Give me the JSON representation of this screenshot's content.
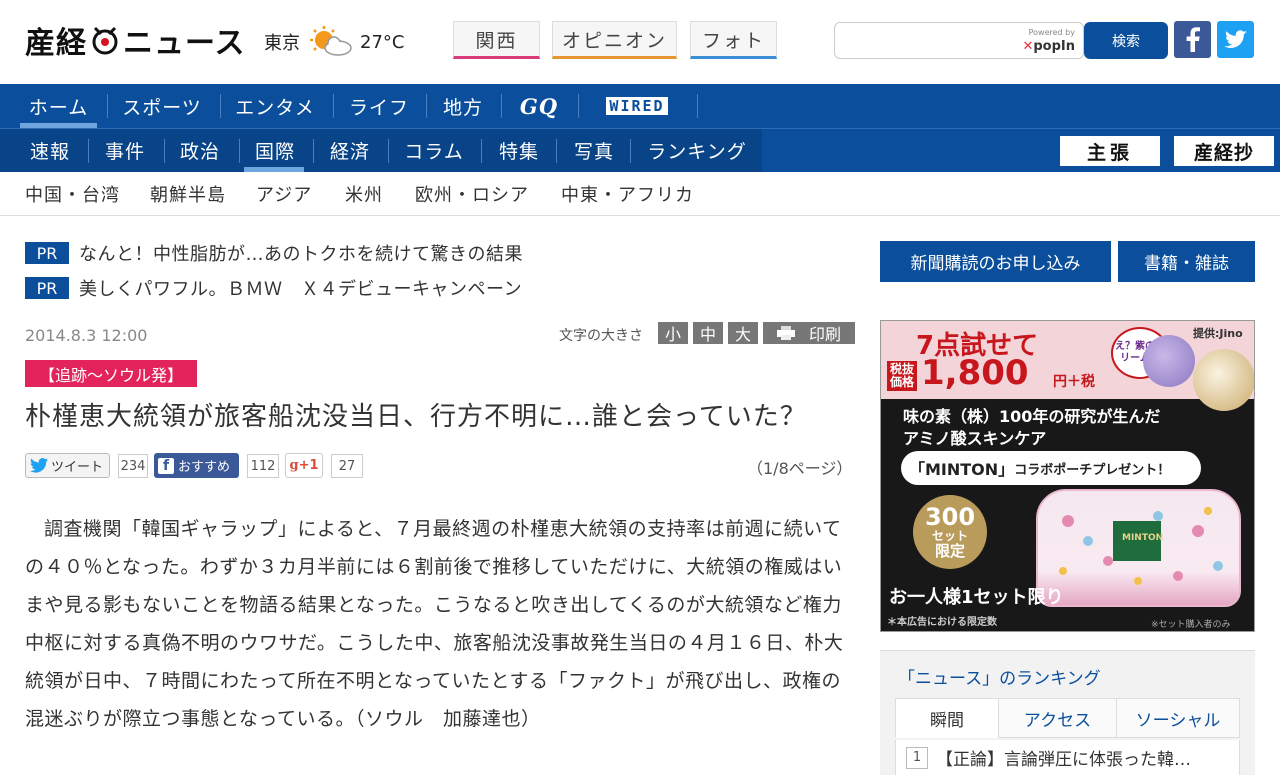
{
  "header": {
    "logo_left": "産経",
    "logo_right": "ニュース",
    "weather": {
      "city": "東京",
      "icon": "sun-cloud-icon",
      "temp": "27°C"
    },
    "tabs": [
      {
        "label": "関西",
        "underline": "#d83a7a"
      },
      {
        "label": "オピニオン",
        "underline": "#e8962e"
      },
      {
        "label": "フォト",
        "underline": "#3a8fd8"
      }
    ],
    "search": {
      "placeholder": "",
      "powered_by": "Powered by",
      "provider": "popIn",
      "button": "検索"
    },
    "social": [
      {
        "name": "facebook-icon",
        "color": "#3b5998"
      },
      {
        "name": "twitter-icon",
        "color": "#1da1f2"
      }
    ]
  },
  "nav": {
    "primary": [
      "ホーム",
      "スポーツ",
      "エンタメ",
      "ライフ",
      "地方",
      "GQ",
      "WIRED"
    ],
    "primary_active": "ホーム",
    "secondary": [
      "速報",
      "事件",
      "政治",
      "国際",
      "経済",
      "コラム",
      "特集",
      "写真",
      "ランキング"
    ],
    "secondary_active": "国際",
    "buttons": [
      "主張",
      "産経抄"
    ],
    "sub": [
      "中国・台湾",
      "朝鮮半島",
      "アジア",
      "米州",
      "欧州・ロシア",
      "中東・アフリカ"
    ]
  },
  "pr": [
    {
      "tag": "PR",
      "text": "なんと！中性脂肪が…あのトクホを続けて驚きの結果"
    },
    {
      "tag": "PR",
      "text": "美しくパワフル。ＢＭＷ　Ｘ４デビューキャンペーン"
    }
  ],
  "article": {
    "date": "2014.8.3 12:00",
    "font_size_label": "文字の大きさ",
    "font_sizes": [
      "小",
      "中",
      "大"
    ],
    "print_label": "印刷",
    "category": "【追跡～ソウル発】",
    "headline": "朴槿恵大統領が旅客船沈没当日、行方不明に…誰と会っていた？",
    "share": {
      "tweet_label": "ツイート",
      "tweet_count": "234",
      "fb_label": "おすすめ",
      "fb_count": "112",
      "gplus_label": "+1",
      "gplus_count": "27"
    },
    "page_indicator": "（1/8ページ）",
    "body": "調査機関「韓国ギャラップ」によると、７月最終週の朴槿恵大統領の支持率は前週に続いての４０％となった。わずか３カ月半前には６割前後で推移していただけに、大統領の権威はいまや見る影もないことを物語る結果となった。こうなると吹き出してくるのが大統領など権力中枢に対する真偽不明のウワサだ。こうした中、旅客船沈没事故発生当日の４月１６日、朴大統領が日中、７時間にわたって所在不明となっていたとする「ファクト」が飛び出し、政権の混迷ぶりが際立つ事態となっている。（ソウル　加藤達也）"
  },
  "sidebar": {
    "buttons": [
      "新聞購読のお申し込み",
      "書籍・雑誌"
    ],
    "ad": {
      "headline": "7点試せて",
      "price_label": "税抜価格",
      "price": "1,800",
      "price_suffix": "円＋税",
      "bubble": "え？紫のクリーム！",
      "provider": "提供:Jino",
      "copy1": "味の素（株）100年の研究が生んだ",
      "copy2": "アミノ酸スキンケア",
      "promo_brand": "「MINTON」",
      "promo_rest": "コラボポーチプレゼント！",
      "limit_num": "300",
      "limit_unit": "セット",
      "limit_word": "限定",
      "one_per": "お一人様1セット限り",
      "note_left": "＊本広告における限定数",
      "note_right": "※セット購入者のみ",
      "pouch_brand": "MINTON"
    },
    "ranking": {
      "title": "「ニュース」のランキング",
      "tabs": [
        "瞬間",
        "アクセス",
        "ソーシャル"
      ],
      "items": [
        {
          "rank": "1",
          "text": "【正論】言論弾圧に体張った韓…"
        }
      ]
    }
  }
}
